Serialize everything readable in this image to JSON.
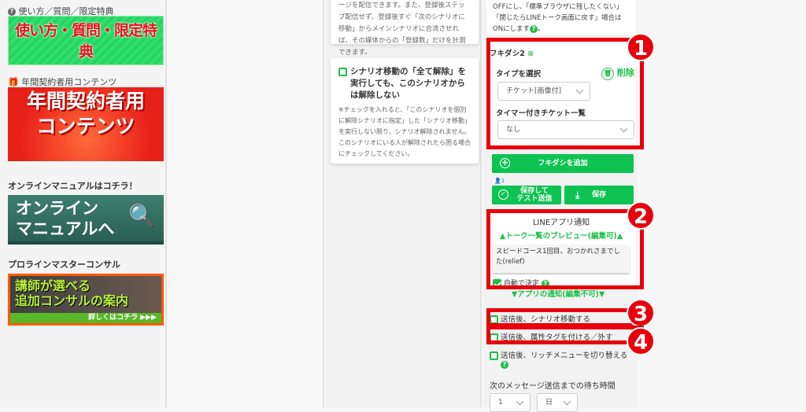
{
  "sidebar": {
    "section1_title": "使い方／質問／限定特典",
    "banner1_text": "使い方・質問・限定特典",
    "section2_title": "年間契約者用コンテンツ",
    "banner2_line1": "年間契約者用",
    "banner2_line2": "コンテンツ",
    "section3_title": "オンラインマニュアルはコチラ！",
    "banner3_line1": "オンライン",
    "banner3_line2": "マニュアルへ",
    "section4_title": "プロラインマスターコンサル",
    "banner4_line1": "講師が選べる",
    "banner4_line2": "追加コンサルの案内",
    "banner4_more": "詳しくはコチラ ▶▶▶"
  },
  "middle": {
    "card1_text": "ージを配信できます。また、登録後ステップ配信せず、登録後すぐ「次のシナリオに移動」からメインシナリオに合流させれば、その媒体からの「登録数」だけを計測できます。",
    "card2_title": "シナリオ移動の「全て解除」を実行しても、このシナリオからは解除しない",
    "card2_note": "※チェックを入れると、「このシナリオを個別に解除シナリオに指定」した「シナリオ移動」を実行しない限り、シナリオ解除されません。このシナリオにいる人が解除されたら困る場合にチェックしてください。"
  },
  "right": {
    "top_text": "OFFにし、「標準ブラウザに残したくない」「閉じたらLINEトーク画面に戻す」場合はONにします",
    "fukidashi_title": "フキダシ2",
    "type_label": "タイプを選択",
    "delete_label": "削除",
    "type_value": "チケット[画像付]",
    "timer_label": "タイマー付きチケット一覧",
    "timer_value": "なし",
    "add_button": "フキダシを追加",
    "user_count": "1",
    "save_test_line1": "保存して",
    "save_test_line2": "テスト送信",
    "save_button": "保存",
    "line_notice_title": "LINEアプリ通知",
    "preview_label": "▲トーク一覧のプレビュー(編集可)▲",
    "preview_text": "スピードコース1回目、おつかれさまでした(relief)",
    "auto_label": "自動で決定",
    "app_notice_label": "▼アプリの通知(編集不可)▼",
    "opt1": "送信後、シナリオ移動する",
    "opt2": "送信後、属性タグを付ける／外す",
    "opt3": "送信後、リッチメニューを切り替える",
    "wait_label": "次のメッセージ送信までの待ち時間",
    "wait_value": "1",
    "wait_unit": "日",
    "badges": [
      "1",
      "2",
      "3",
      "4"
    ]
  },
  "colors": {
    "accent": "#0ec351",
    "highlight": "#e8000b"
  }
}
